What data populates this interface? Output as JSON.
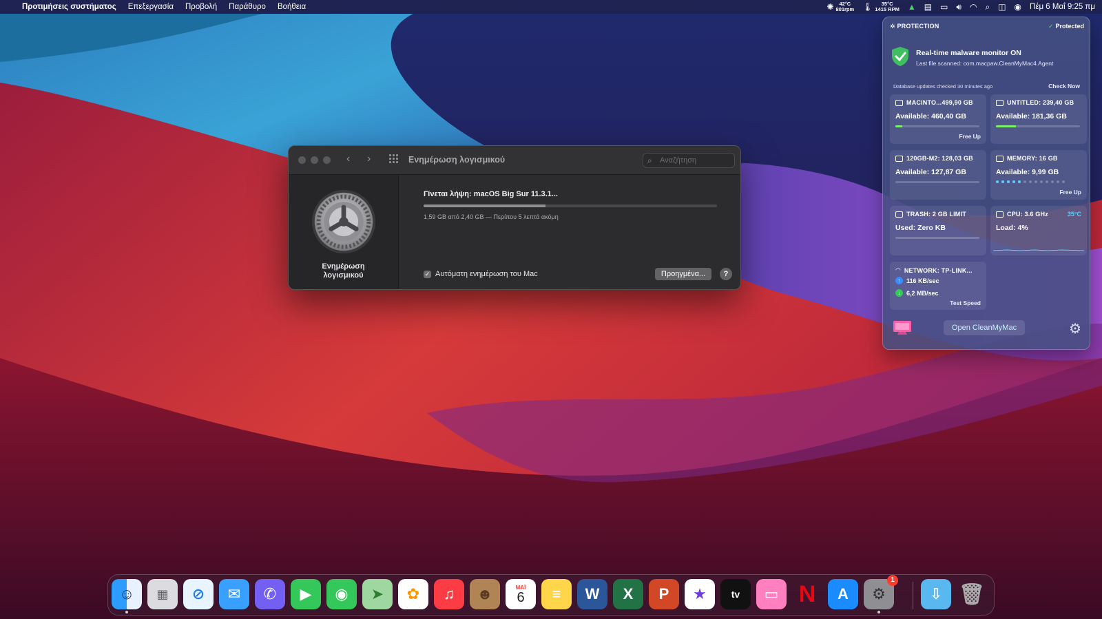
{
  "menubar": {
    "app_name": "Προτιμήσεις συστήματος",
    "menus": [
      "Επεξεργασία",
      "Προβολή",
      "Παράθυρο",
      "Βοήθεια"
    ],
    "fan": {
      "temp": "42°C",
      "rpm": "801rpm"
    },
    "sensor": {
      "temp": "35°C",
      "rpm": "1415 RPM"
    },
    "datetime": "Πέμ 6 Μαΐ  9:25 πμ"
  },
  "window": {
    "title": "Ενημέρωση λογισμικού",
    "search_placeholder": "Αναζήτηση",
    "side_label_line1": "Ενημέρωση",
    "side_label_line2": "λογισμικού",
    "download_title": "Γίνεται λήψη: macOS Big Sur 11.3.1...",
    "progress_fraction": 0.415,
    "download_detail": "1,59 GB από 2,40 GB — Περίπου 5 λεπτά ακόμη",
    "auto_update_label": "Αυτόματη ενημέρωση του Mac",
    "auto_update_checked": true,
    "advanced_label": "Προηγμένα...",
    "help_label": "?"
  },
  "cleanmymac": {
    "protection": {
      "header": "PROTECTION",
      "status": "Protected",
      "title": "Real-time malware monitor ON",
      "last_file": "Last file scanned: com.macpaw.CleanMyMac4.Agent",
      "db_updates": "Database updates checked 30 minutes ago",
      "check_now": "Check Now"
    },
    "tiles": {
      "disk1": {
        "header": "MACINTO...499,90 GB",
        "main": "Available: 460,40 GB",
        "used_fraction": 0.08,
        "action": "Free Up"
      },
      "disk2": {
        "header": "UNTITLED: 239,40 GB",
        "main": "Available: 181,36 GB",
        "used_fraction": 0.24
      },
      "disk3": {
        "header": "120GB-M2: 128,03 GB",
        "main": "Available: 127,87 GB",
        "used_fraction": 0.0
      },
      "memory": {
        "header": "MEMORY: 16 GB",
        "main": "Available: 9,99 GB",
        "used_dots": 5,
        "total_dots": 13,
        "action": "Free Up"
      },
      "trash": {
        "header": "TRASH: 2 GB LIMIT",
        "main": "Used: Zero KB"
      },
      "cpu": {
        "header": "CPU: 3.6 GHz",
        "temp": "35°C",
        "main": "Load: 4%"
      },
      "network": {
        "header": "NETWORK: TP-LINK...",
        "upload": "116 KB/sec",
        "download": "6,2 MB/sec",
        "action": "Test Speed"
      }
    },
    "open_button": "Open CleanMyMac"
  },
  "calendar": {
    "month": "ΜΑΪ",
    "day": "6"
  },
  "dock_badge": "1",
  "colors": {
    "accent_green": "#7cf06a",
    "accent_cyan": "#5fd0ff",
    "window_bg": "#2c2c2e"
  }
}
